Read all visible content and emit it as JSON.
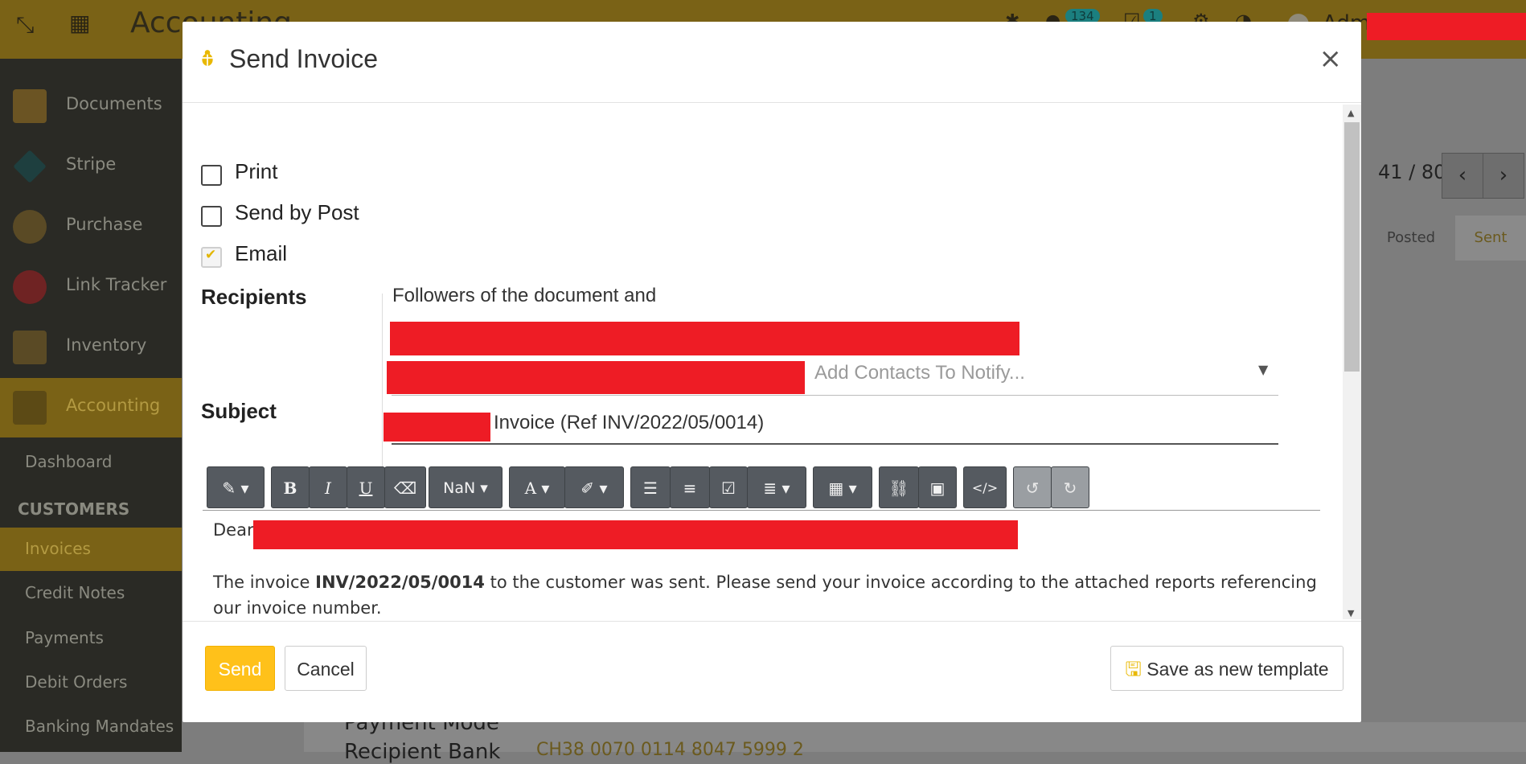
{
  "topbar": {
    "app_name": "Accounting",
    "badge_messages": "134",
    "badge_activities": "1",
    "user": "Adm"
  },
  "sidebar": {
    "apps": [
      {
        "label": "Documents"
      },
      {
        "label": "Stripe"
      },
      {
        "label": "Purchase"
      },
      {
        "label": "Link Tracker"
      },
      {
        "label": "Inventory"
      },
      {
        "label": "Accounting"
      }
    ],
    "dashboard": "Dashboard",
    "section": "CUSTOMERS",
    "sub_items": [
      {
        "label": "Invoices"
      },
      {
        "label": "Credit Notes"
      },
      {
        "label": "Payments"
      },
      {
        "label": "Debit Orders"
      },
      {
        "label": "Banking Mandates"
      }
    ]
  },
  "background": {
    "pager": "41 / 80",
    "stage_posted": "Posted",
    "stage_sent": "Sent",
    "payment_mode_label": "Payment Mode",
    "recipient_bank_label": "Recipient Bank",
    "recipient_bank_value": "CH38 0070 0114 8047 5999 2"
  },
  "modal": {
    "title": "Send Invoice",
    "close": "×",
    "options": [
      {
        "label": "Print",
        "checked": false
      },
      {
        "label": "Send by Post",
        "checked": false
      },
      {
        "label": "Email",
        "checked": true
      }
    ],
    "recipients_label": "Recipients",
    "recipients_text": "Followers of the document and",
    "contacts_placeholder": "Add Contacts To Notify...",
    "subject_label": "Subject",
    "subject_value": "Invoice (Ref INV/2022/05/0014)",
    "toolbar": {
      "font_size": "NaN"
    },
    "body": {
      "greeting": "Dear",
      "line_prefix": "The invoice ",
      "invoice_ref": "INV/2022/05/0014",
      "line_suffix": " to the customer was sent. Please send your invoice according to the attached reports referencing our invoice number."
    },
    "footer": {
      "send": "Send",
      "cancel": "Cancel",
      "save_template": "Save as new template"
    }
  },
  "colors": {
    "accent": "#ffc11a",
    "redaction": "#ee1c25",
    "topbar": "#7a6216"
  }
}
